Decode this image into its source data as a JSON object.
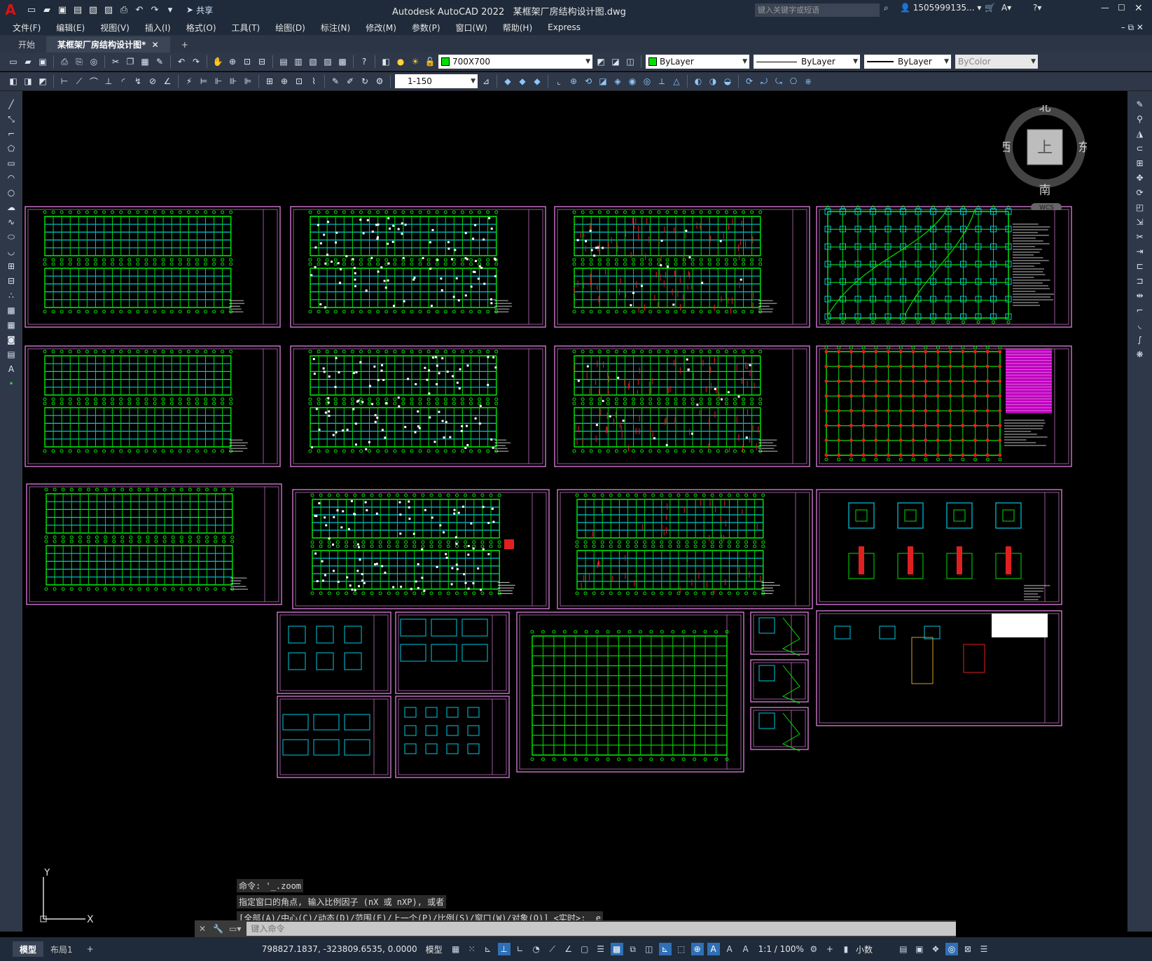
{
  "app": {
    "title": "Autodesk AutoCAD 2022",
    "filename": "某框架厂房结构设计图.dwg",
    "logo": "A"
  },
  "quick_access": {
    "share_label": "共享"
  },
  "search": {
    "placeholder": "键入关键字或短语"
  },
  "user": {
    "name": "1505999135..."
  },
  "menu": [
    "文件(F)",
    "编辑(E)",
    "视图(V)",
    "插入(I)",
    "格式(O)",
    "工具(T)",
    "绘图(D)",
    "标注(N)",
    "修改(M)",
    "参数(P)",
    "窗口(W)",
    "帮助(H)",
    "Express"
  ],
  "tabs": [
    {
      "label": "开始"
    },
    {
      "label": "某框架厂房结构设计图*"
    }
  ],
  "toolbar1": {
    "layer_name": "700X700",
    "color": "ByLayer",
    "linetype": "ByLayer",
    "lineweight": "ByLayer",
    "plotstyle": "ByColor"
  },
  "toolbar2": {
    "scale": "1-150"
  },
  "viewcube": {
    "north": "北",
    "south": "南",
    "east": "东",
    "west": "西",
    "top": "上",
    "wcs": "WCS"
  },
  "ucs": {
    "y": "Y",
    "x": "X"
  },
  "command": {
    "history": [
      "命令: '_.zoom",
      "指定窗口的角点, 输入比例因子 (nX 或 nXP), 或者",
      "[全部(A)/中心(C)/动态(D)/范围(E)/上一个(P)/比例(S)/窗口(W)/对象(O)] <实时>: _e"
    ],
    "placeholder": "键入命令"
  },
  "status": {
    "model_tab": "模型",
    "layout_tab": "布局1",
    "add_tab": "+",
    "coords": "798827.1837, -323809.6535, 0.0000",
    "space": "模型",
    "scale": "1:1 / 100%",
    "units": "小数"
  },
  "colors": {
    "sheet_border": "#c070c0",
    "grid_green": "#00e000",
    "grid_cyan": "#00c8e0",
    "red": "#e02020"
  }
}
